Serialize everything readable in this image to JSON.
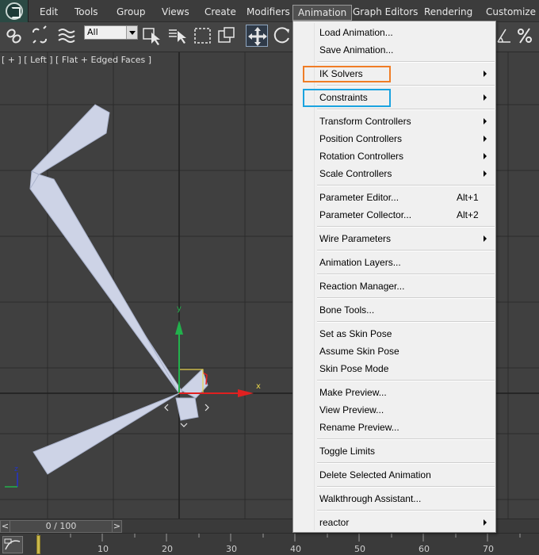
{
  "menubar": {
    "items": [
      "Edit",
      "Tools",
      "Group",
      "Views",
      "Create",
      "Modifiers",
      "Animation",
      "Graph Editors",
      "Rendering",
      "Customize"
    ],
    "active": "Animation"
  },
  "toolbar": {
    "selection_filter": "All"
  },
  "viewport": {
    "label": "[ + ] [ Left ] [ Flat + Edged Faces ]",
    "axis_x": "x",
    "axis_y": "y",
    "mini_axis_z": "z"
  },
  "timeslider": {
    "value": "0 / 100",
    "prev": "<",
    "next": ">"
  },
  "trackbar": {
    "ticks": [
      "10",
      "20",
      "30",
      "40",
      "50",
      "60",
      "70"
    ]
  },
  "animation_menu": {
    "items": [
      {
        "label": "Load Animation...",
        "shortcut": "",
        "submenu": false
      },
      {
        "label": "Save Animation...",
        "shortcut": "",
        "submenu": false
      },
      {
        "label": "IK Solvers",
        "shortcut": "",
        "submenu": true
      },
      {
        "label": "Constraints",
        "shortcut": "",
        "submenu": true
      },
      {
        "label": "Transform Controllers",
        "shortcut": "",
        "submenu": true
      },
      {
        "label": "Position Controllers",
        "shortcut": "",
        "submenu": true
      },
      {
        "label": "Rotation Controllers",
        "shortcut": "",
        "submenu": true
      },
      {
        "label": "Scale Controllers",
        "shortcut": "",
        "submenu": true
      },
      {
        "label": "Parameter Editor...",
        "shortcut": "Alt+1",
        "submenu": false
      },
      {
        "label": "Parameter Collector...",
        "shortcut": "Alt+2",
        "submenu": false
      },
      {
        "label": "Wire Parameters",
        "shortcut": "",
        "submenu": true
      },
      {
        "label": "Animation Layers...",
        "shortcut": "",
        "submenu": false
      },
      {
        "label": "Reaction Manager...",
        "shortcut": "",
        "submenu": false
      },
      {
        "label": "Bone Tools...",
        "shortcut": "",
        "submenu": false
      },
      {
        "label": "Set as Skin Pose",
        "shortcut": "",
        "submenu": false
      },
      {
        "label": "Assume Skin Pose",
        "shortcut": "",
        "submenu": false
      },
      {
        "label": "Skin Pose Mode",
        "shortcut": "",
        "submenu": false
      },
      {
        "label": "Make Preview...",
        "shortcut": "",
        "submenu": false
      },
      {
        "label": "View Preview...",
        "shortcut": "",
        "submenu": false
      },
      {
        "label": "Rename Preview...",
        "shortcut": "",
        "submenu": false
      },
      {
        "label": "Toggle Limits",
        "shortcut": "",
        "submenu": false
      },
      {
        "label": "Delete Selected Animation",
        "shortcut": "",
        "submenu": false
      },
      {
        "label": "Walkthrough Assistant...",
        "shortcut": "",
        "submenu": false
      },
      {
        "label": "reactor",
        "shortcut": "",
        "submenu": true
      }
    ],
    "highlights": [
      {
        "item": "IK Solvers",
        "color": "#f07d26"
      },
      {
        "item": "Constraints",
        "color": "#1aa3e0"
      }
    ]
  },
  "colors": {
    "viewport_bg": "#404040",
    "grid_line": "#2b2b2b",
    "bone_fill": "#cdd3e6",
    "axis_x": "#e02020",
    "axis_y": "#22b14c",
    "axis_z": "#2233cc",
    "menu_bg": "#f0f0f0"
  }
}
